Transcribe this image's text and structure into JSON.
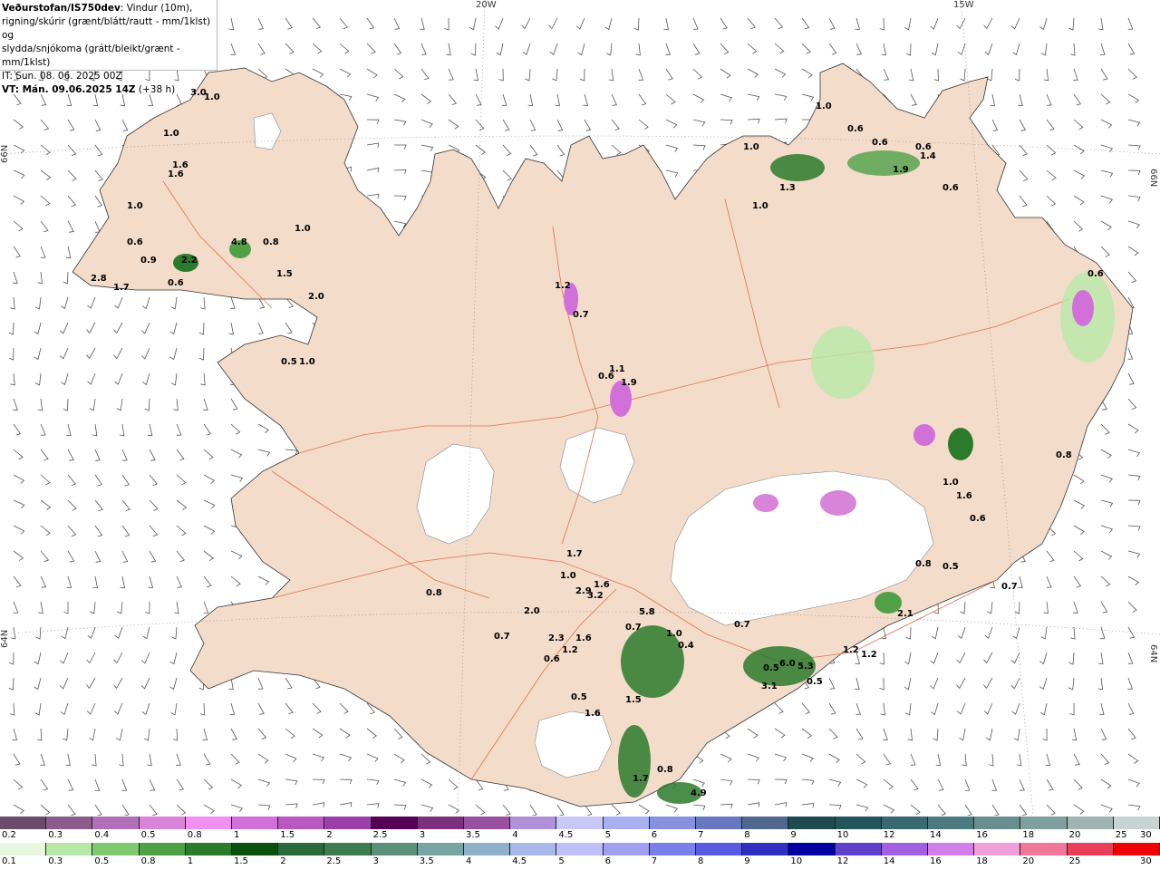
{
  "header": {
    "brand": "Veðurstofan/IS750dev",
    "line1_rest": ": Vindur (10m),",
    "line2": "rigning/skúrir (grænt/blátt/rautt - mm/1klst) og",
    "line3": "slydda/snjókoma (grátt/bleikt/grænt - mm/1klst)",
    "line4": "IT: Sun. 08. 06. 2025 00Z",
    "line5_prefix": "VT: Mán. 09.06.2025 14Z",
    "line5_suffix": " (+38 h)"
  },
  "graticule": {
    "lon_labels": [
      "20W",
      "15W"
    ],
    "lat_labels": [
      "66N",
      "64N"
    ]
  },
  "map_labels": [
    "3.0",
    "1.0",
    "1.0",
    "1.6",
    "1.6",
    "1.0",
    "0.6",
    "0.8",
    "1.0",
    "4.8",
    "2.2",
    "0.9",
    "0.6",
    "1.5",
    "2.0",
    "2.8",
    "1.7",
    "0.5",
    "1.0",
    "1.2",
    "0.7",
    "0.6",
    "1.1",
    "1.9",
    "1.0",
    "0.6",
    "0.6",
    "1.0",
    "1.0",
    "0.6",
    "1.4",
    "1.9",
    "1.3",
    "1.0",
    "0.6",
    "1.7",
    "1.0",
    "2.9",
    "1.6",
    "0.8",
    "2.0",
    "0.7",
    "2.3",
    "1.6",
    "1.2",
    "0.6",
    "0.5",
    "1.6",
    "1.5",
    "0.7",
    "0.8",
    "1.7",
    "4.9",
    "5.8",
    "1.0",
    "0.4",
    "0.7",
    "0.5",
    "6.0",
    "5.3",
    "3.1",
    "0.5",
    "1.2",
    "1.2",
    "0.7",
    "0.8",
    "0.6",
    "1.6",
    "0.6",
    "0.8",
    "0.5",
    "3.2",
    "2.1"
  ],
  "legend_snow": {
    "labels": [
      "0.2",
      "0.3",
      "0.4",
      "0.5",
      "0.8",
      "1",
      "1.5",
      "2",
      "2.5",
      "3",
      "3.5",
      "4",
      "4.5",
      "5",
      "6",
      "7",
      "8",
      "9",
      "10",
      "12",
      "14",
      "16",
      "18",
      "20",
      "25",
      "30"
    ],
    "colors": [
      "#6b4a6b",
      "#8c5c8c",
      "#b070b8",
      "#d884d8",
      "#f090f0",
      "#d070d8",
      "#b858c0",
      "#9a40a8",
      "#550055",
      "#7a307a",
      "#9a50a0",
      "#b090d8",
      "#c8c8f8",
      "#a8b0f0",
      "#8890e0",
      "#6878c0",
      "#506890",
      "#1e4a50",
      "#24545c",
      "#386870",
      "#4c7a80",
      "#688e90",
      "#80a0a0",
      "#a0b4b4",
      "#c8d4d4"
    ]
  },
  "legend_rain": {
    "labels": [
      "0.1",
      "0.3",
      "0.5",
      "0.8",
      "1",
      "1.5",
      "2",
      "2.5",
      "3",
      "3.5",
      "4",
      "4.5",
      "5",
      "6",
      "7",
      "8",
      "9",
      "10",
      "12",
      "14",
      "16",
      "18",
      "20",
      "25",
      "30"
    ],
    "colors": [
      "#e8f8e0",
      "#b8e8a8",
      "#80c870",
      "#50a048",
      "#2c7a2c",
      "#0c5010",
      "#2a6a3a",
      "#3c7c50",
      "#5a907a",
      "#7aa4a4",
      "#90b0c8",
      "#a8b8e8",
      "#c0c0f8",
      "#a0a0f0",
      "#7a80e8",
      "#5a5ae0",
      "#3030c0",
      "#0000a0",
      "#6040c8",
      "#a060e0",
      "#d080e8",
      "#f0a0d8",
      "#f07898",
      "#e84058",
      "#f00000"
    ]
  }
}
